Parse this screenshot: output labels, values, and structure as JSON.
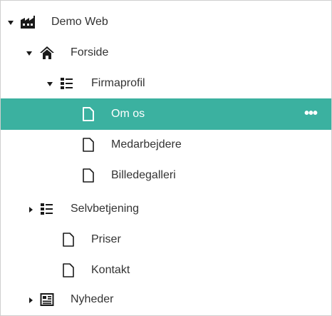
{
  "tree": {
    "root": {
      "label": "Demo Web",
      "icon": "factory-icon",
      "expanded": true
    },
    "forside": {
      "label": "Forside",
      "icon": "home-icon",
      "expanded": true
    },
    "firmaprofil": {
      "label": "Firmaprofil",
      "icon": "list-icon",
      "expanded": true
    },
    "om_os": {
      "label": "Om os",
      "icon": "page-icon",
      "selected": true,
      "more_label": "•••"
    },
    "medarbejdere": {
      "label": "Medarbejdere",
      "icon": "page-icon"
    },
    "billedegalleri": {
      "label": "Billedegalleri",
      "icon": "page-icon"
    },
    "selvbetjening": {
      "label": "Selvbetjening",
      "icon": "list-icon",
      "expanded": false
    },
    "priser": {
      "label": "Priser",
      "icon": "page-icon"
    },
    "kontakt": {
      "label": "Kontakt",
      "icon": "page-icon"
    },
    "nyheder": {
      "label": "Nyheder",
      "icon": "news-icon",
      "expanded": false
    }
  },
  "colors": {
    "selected_bg": "#3bb1a0",
    "text": "#333333",
    "icon": "#1a1a1a"
  }
}
